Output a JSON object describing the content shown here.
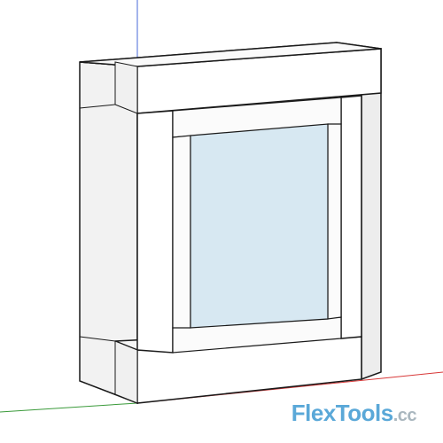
{
  "description": "SketchUp 3D viewport showing a white window frame component with light blue glass pane, rendered in perspective with RGB axis lines visible",
  "scene": {
    "object": "window-frame-component",
    "glass_color": "#d7e8f2",
    "frame_color": "#ffffff",
    "edge_color": "#1a1a1a",
    "axes": {
      "x_color": "#d83838",
      "y_color": "#3a9a3a",
      "z_color": "#4a6ad8"
    }
  },
  "watermark": {
    "brand": "FlexTools",
    "suffix": ".cc"
  }
}
